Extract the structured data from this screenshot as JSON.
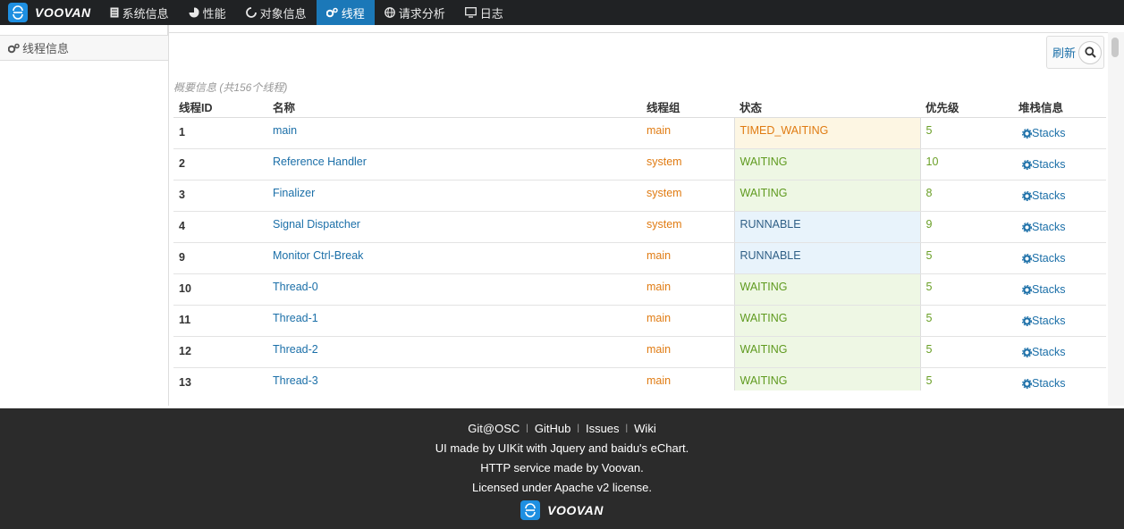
{
  "brand": {
    "name": "VOOVAN",
    "logo_color": "#1e8fe1"
  },
  "nav": [
    {
      "label": "系统信息",
      "icon": "document-icon"
    },
    {
      "label": "性能",
      "icon": "pie-icon"
    },
    {
      "label": "对象信息",
      "icon": "circle-notch-icon"
    },
    {
      "label": "线程",
      "icon": "gears-icon",
      "active": true
    },
    {
      "label": "请求分析",
      "icon": "globe-icon"
    },
    {
      "label": "日志",
      "icon": "monitor-icon"
    }
  ],
  "sidebar": {
    "items": [
      {
        "label": "线程信息",
        "icon": "gears-icon"
      }
    ]
  },
  "toolbar": {
    "refresh_label": "刷新"
  },
  "summary": "概要信息 (共156个线程)",
  "table": {
    "headers": {
      "id": "线程ID",
      "name": "名称",
      "group": "线程组",
      "state": "状态",
      "priority": "优先级",
      "stack": "堆栈信息"
    },
    "rows": [
      {
        "id": "1",
        "name": "main",
        "group": "main",
        "state": "TIMED_WAITING",
        "priority": "5",
        "stack": "Stacks"
      },
      {
        "id": "2",
        "name": "Reference Handler",
        "group": "system",
        "state": "WAITING",
        "priority": "10",
        "stack": "Stacks"
      },
      {
        "id": "3",
        "name": "Finalizer",
        "group": "system",
        "state": "WAITING",
        "priority": "8",
        "stack": "Stacks"
      },
      {
        "id": "4",
        "name": "Signal Dispatcher",
        "group": "system",
        "state": "RUNNABLE",
        "priority": "9",
        "stack": "Stacks"
      },
      {
        "id": "9",
        "name": "Monitor Ctrl-Break",
        "group": "main",
        "state": "RUNNABLE",
        "priority": "5",
        "stack": "Stacks"
      },
      {
        "id": "10",
        "name": "Thread-0",
        "group": "main",
        "state": "WAITING",
        "priority": "5",
        "stack": "Stacks"
      },
      {
        "id": "11",
        "name": "Thread-1",
        "group": "main",
        "state": "WAITING",
        "priority": "5",
        "stack": "Stacks"
      },
      {
        "id": "12",
        "name": "Thread-2",
        "group": "main",
        "state": "WAITING",
        "priority": "5",
        "stack": "Stacks"
      },
      {
        "id": "13",
        "name": "Thread-3",
        "group": "main",
        "state": "WAITING",
        "priority": "5",
        "stack": "Stacks"
      }
    ]
  },
  "footer": {
    "links": [
      "Git@OSC",
      "GitHub",
      "Issues",
      "Wiki"
    ],
    "line1": "UI made by UIKit with Jquery and baidu's eChart.",
    "line2": "HTTP service made by Voovan.",
    "line3": "Licensed under Apache v2 license.",
    "brand": "VOOVAN"
  }
}
